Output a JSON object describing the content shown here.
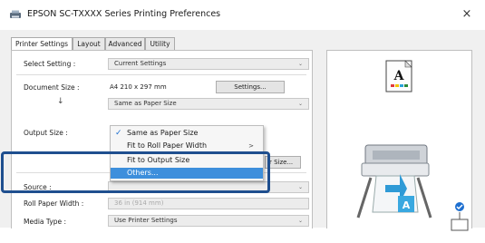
{
  "window": {
    "title": "EPSON SC-TXXXX Series Printing Preferences",
    "close_glyph": "×",
    "app_icon": "printer-icon"
  },
  "tabs": [
    {
      "label": "Printer Settings",
      "active": true
    },
    {
      "label": "Layout",
      "active": false
    },
    {
      "label": "Advanced",
      "active": false
    },
    {
      "label": "Utility",
      "active": false
    }
  ],
  "form": {
    "select_setting": {
      "label": "Select Setting :",
      "value": "Current Settings"
    },
    "document_size": {
      "label": "Document Size :",
      "value": "A4 210 x 297 mm",
      "button": "Settings..."
    },
    "down_arrow": "↓",
    "size_combo": {
      "value": "Same as Paper Size"
    },
    "output_size": {
      "label": "Output Size :",
      "button_partial": "r Size..."
    },
    "source": {
      "label": "Source :"
    },
    "roll_paper_width": {
      "label": "Roll Paper Width :",
      "value": "36 in (914 mm)"
    },
    "media_type": {
      "label": "Media Type :",
      "value": "Use Printer Settings"
    }
  },
  "dropdown": {
    "items": [
      {
        "label": "Same as Paper Size",
        "checked": true,
        "submenu": false,
        "selected": false
      },
      {
        "label": "Fit to Roll Paper Width",
        "checked": false,
        "submenu": true,
        "selected": false
      },
      {
        "label": "Fit to Output Size",
        "checked": false,
        "submenu": false,
        "selected": false
      },
      {
        "label": "Others...",
        "checked": false,
        "submenu": false,
        "selected": true
      }
    ],
    "check_glyph": "✓",
    "submenu_glyph": ">"
  },
  "preview": {
    "paper_letter": "A",
    "icons": [
      "paper-preview-icon",
      "printer-icon",
      "blue-arrow-icon",
      "roll-paper-icon"
    ]
  },
  "colors": {
    "accent": "#1e6fd0",
    "highlight_border": "#1f4f8f",
    "selection": "#3d8fdc"
  }
}
